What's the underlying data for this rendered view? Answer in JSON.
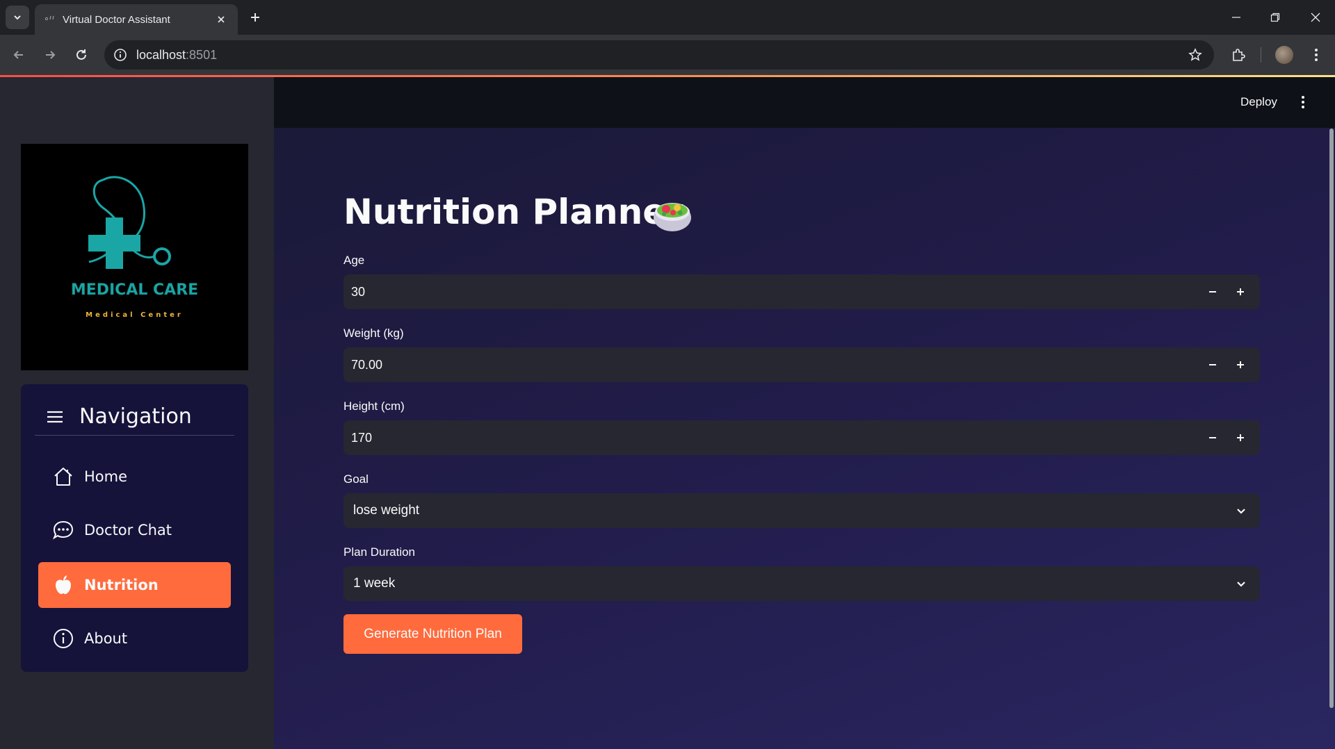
{
  "browser": {
    "tab_title": "Virtual Doctor Assistant",
    "url_host": "localhost",
    "url_port": ":8501"
  },
  "app_header": {
    "deploy_label": "Deploy"
  },
  "sidebar": {
    "logo": {
      "title": "MEDICAL CARE",
      "subtitle": "Medical Center"
    },
    "nav_title": "Navigation",
    "items": [
      {
        "label": "Home",
        "icon": "home-icon",
        "active": false
      },
      {
        "label": "Doctor Chat",
        "icon": "chat-icon",
        "active": false
      },
      {
        "label": "Nutrition",
        "icon": "apple-icon",
        "active": true
      },
      {
        "label": "About",
        "icon": "info-icon",
        "active": false
      }
    ]
  },
  "main": {
    "title": "Nutrition Planner",
    "title_icon": "salad-icon",
    "fields": {
      "age": {
        "label": "Age",
        "value": "30"
      },
      "weight": {
        "label": "Weight (kg)",
        "value": "70.00"
      },
      "height": {
        "label": "Height (cm)",
        "value": "170"
      },
      "goal": {
        "label": "Goal",
        "value": "lose weight"
      },
      "duration": {
        "label": "Plan Duration",
        "value": "1 week"
      }
    },
    "generate_label": "Generate Nutrition Plan"
  },
  "colors": {
    "accent": "#ff6b3d",
    "sidebar_bg": "#262730",
    "nav_card_bg": "#15133a",
    "input_bg": "#262730",
    "logo_teal": "#1ba6a6",
    "logo_gold": "#f0b43a"
  }
}
